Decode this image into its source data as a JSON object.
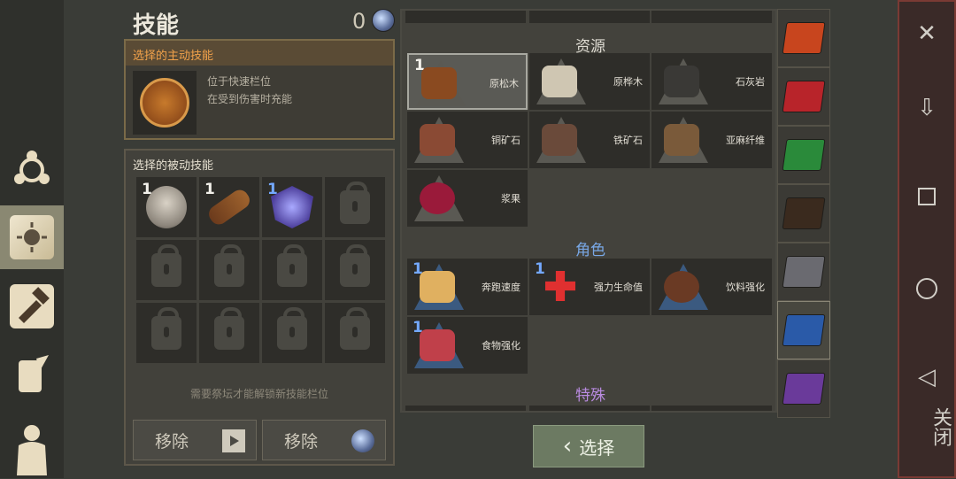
{
  "header": {
    "title": "技能",
    "gem_count": "0"
  },
  "active_skill": {
    "header": "选择的主动技能",
    "desc_line1": "位于快速栏位",
    "desc_line2": "在受到伤害时充能"
  },
  "passive_skills": {
    "header": "选择的被动技能",
    "slots": [
      {
        "type": "portrait",
        "count": "1"
      },
      {
        "type": "log",
        "count": "1"
      },
      {
        "type": "shield",
        "count": "1"
      },
      {
        "type": "locked"
      },
      {
        "type": "locked"
      },
      {
        "type": "locked"
      },
      {
        "type": "locked"
      },
      {
        "type": "locked"
      },
      {
        "type": "locked"
      },
      {
        "type": "locked"
      },
      {
        "type": "locked"
      },
      {
        "type": "locked"
      }
    ],
    "unlock_note": "需要祭坛才能解锁新技能栏位",
    "remove_video_label": "移除",
    "remove_gem_label": "移除"
  },
  "skills_list": {
    "sections": {
      "resources": "资源",
      "character": "角色",
      "special": "特殊"
    },
    "resources": [
      {
        "name": "原松木",
        "count": "1",
        "selected": true,
        "color": "#8a4a20"
      },
      {
        "name": "原桦木",
        "count": "",
        "selected": false,
        "color": "#cfc6b2"
      },
      {
        "name": "石灰岩",
        "count": "",
        "selected": false,
        "color": "#3a3936"
      },
      {
        "name": "铜矿石",
        "count": "",
        "selected": false,
        "color": "#8a4a34"
      },
      {
        "name": "铁矿石",
        "count": "",
        "selected": false,
        "color": "#6a4a3a"
      },
      {
        "name": "亚麻纤维",
        "count": "",
        "selected": false,
        "color": "#7a5a3a"
      },
      {
        "name": "浆果",
        "count": "",
        "selected": false,
        "color": "#9a1a3a"
      }
    ],
    "character": [
      {
        "name": "奔跑速度",
        "count": "1",
        "color": "#e0b060"
      },
      {
        "name": "强力生命值",
        "count": "1",
        "color": "#e03030"
      },
      {
        "name": "饮料强化",
        "count": "",
        "color": "#6a3a24"
      },
      {
        "name": "食物强化",
        "count": "1",
        "color": "#c0404a"
      }
    ]
  },
  "select_button": {
    "label": "选择"
  },
  "system_bar": {
    "close_label": "关闭"
  }
}
